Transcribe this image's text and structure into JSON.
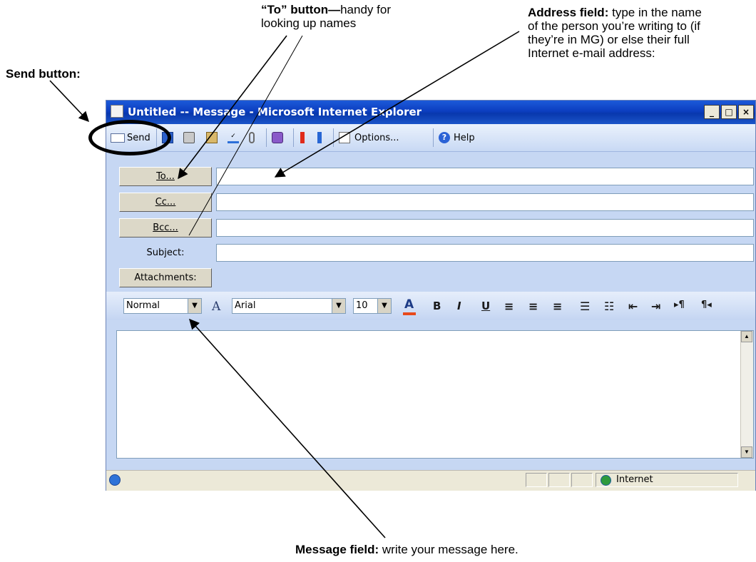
{
  "annotations": {
    "send": {
      "title": "Send button:"
    },
    "to": {
      "title": "“To” button—",
      "text_line1": "handy for",
      "text_line2": "looking up names"
    },
    "address": {
      "title": "Address field:",
      "text_line1": "type in the name",
      "text_line2": "of the person you’re writing to (if",
      "text_line3": "they’re in MG) or else their full",
      "text_line4": "Internet e-mail address:"
    },
    "message": {
      "title": "Message field:",
      "text": "write your message here."
    }
  },
  "window": {
    "title": "Untitled -- Message - Microsoft Internet Explorer",
    "controls": {
      "minimize": "_",
      "maximize": "□",
      "close": "×"
    }
  },
  "toolbar": {
    "send_label": "Send",
    "options_label": "Options...",
    "help_label": "Help"
  },
  "form": {
    "to_button": "To...",
    "cc_button": "Cc...",
    "bcc_button": "Bcc...",
    "subject_label": "Subject:",
    "attachments_button": "Attachments:",
    "to_value": "",
    "cc_value": "",
    "bcc_value": "",
    "subject_value": ""
  },
  "formatting": {
    "style_value": "Normal",
    "font_value": "Arial",
    "size_value": "10",
    "buttons": [
      "B",
      "I",
      "U"
    ]
  },
  "editor": {
    "body": ""
  },
  "status": {
    "zone": "Internet"
  },
  "colors": {
    "title_bar": "#0a3fb8",
    "form_bg": "#c6d7f3",
    "font_color_bar": "#e8491b"
  }
}
